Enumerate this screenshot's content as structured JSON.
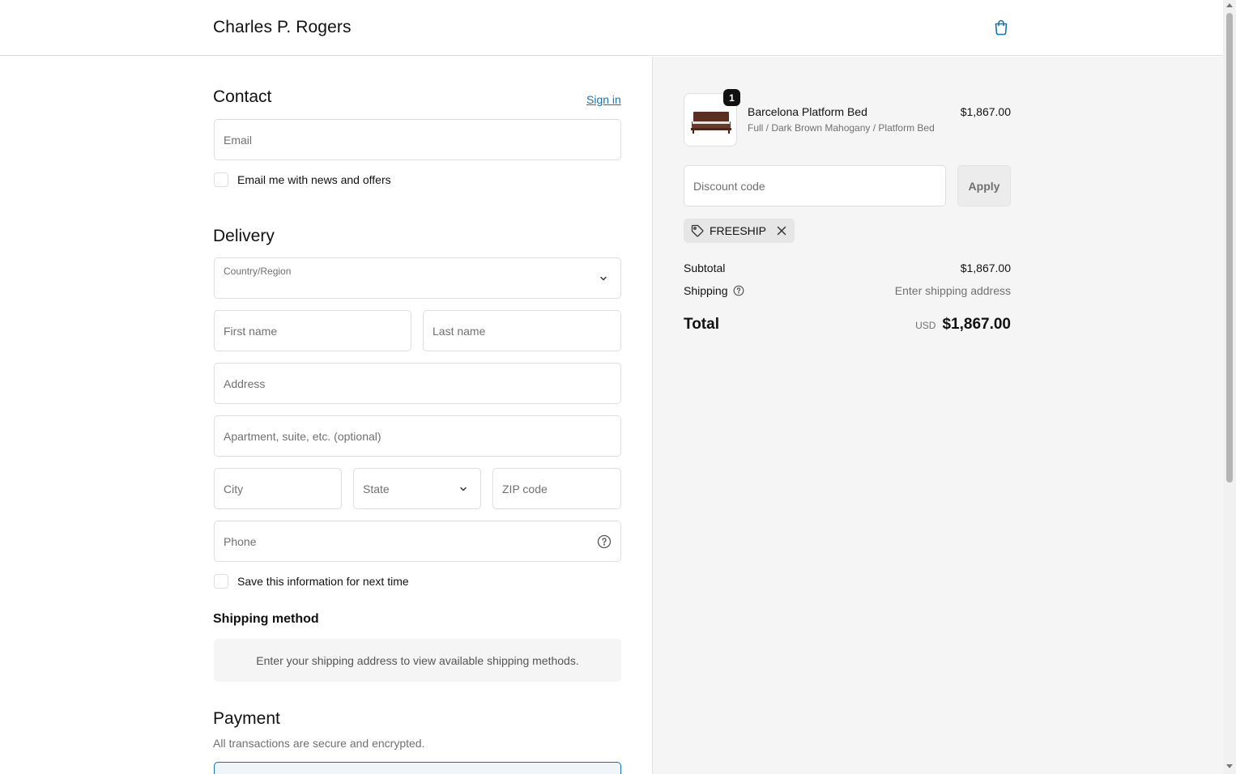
{
  "header": {
    "brand": "Charles P. Rogers",
    "cart_icon": "shopping-bag-icon"
  },
  "contact": {
    "title": "Contact",
    "sign_in": "Sign in",
    "email_placeholder": "Email",
    "newsletter_label": "Email me with news and offers"
  },
  "delivery": {
    "title": "Delivery",
    "country_label": "Country/Region",
    "first_name": "First name",
    "last_name": "Last name",
    "address": "Address",
    "apartment": "Apartment, suite, etc. (optional)",
    "city": "City",
    "state": "State",
    "zip": "ZIP code",
    "phone": "Phone",
    "save_info_label": "Save this information for next time"
  },
  "shipping_method": {
    "title": "Shipping method",
    "message": "Enter your shipping address to view available shipping methods."
  },
  "payment": {
    "title": "Payment",
    "subtitle": "All transactions are secure and encrypted."
  },
  "summary": {
    "item": {
      "quantity": "1",
      "name": "Barcelona Platform Bed",
      "variant": "Full / Dark Brown Mahogany / Platform Bed",
      "price": "$1,867.00"
    },
    "discount_placeholder": "Discount code",
    "apply_label": "Apply",
    "applied_code": "FREESHIP",
    "subtotal_label": "Subtotal",
    "subtotal_value": "$1,867.00",
    "shipping_label": "Shipping",
    "shipping_value": "Enter shipping address",
    "total_label": "Total",
    "currency": "USD",
    "total_value": "$1,867.00"
  },
  "colors": {
    "link": "#1773b0",
    "border": "#dedede",
    "summary_bg": "#f5f5f5"
  }
}
